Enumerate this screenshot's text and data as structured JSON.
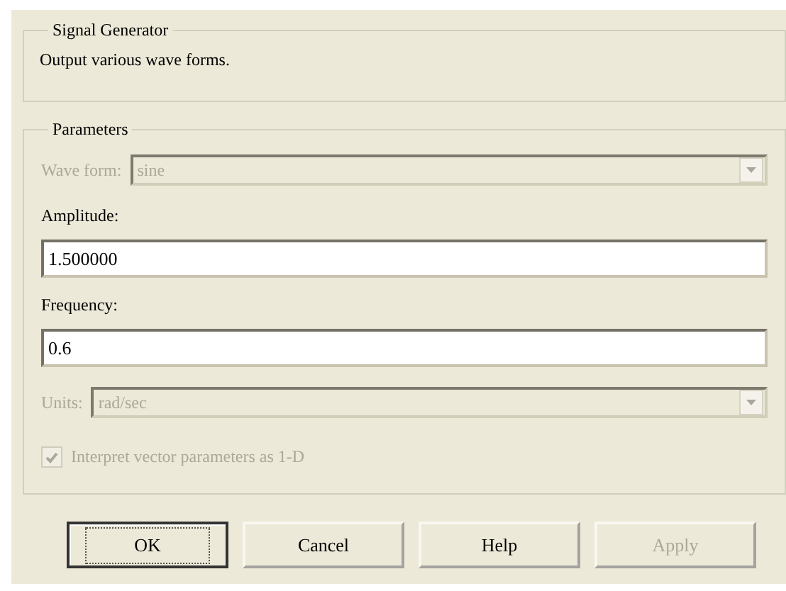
{
  "description_group": {
    "title": "Signal Generator",
    "text": "Output various wave forms."
  },
  "parameters": {
    "title": "Parameters",
    "fields": [
      {
        "kind": "dropdown",
        "label": "Wave form:",
        "value": "sine",
        "disabled": true
      },
      {
        "kind": "text",
        "label": "Amplitude:",
        "value": "1.500000",
        "disabled": false
      },
      {
        "kind": "text",
        "label": "Frequency:",
        "value": "0.6",
        "disabled": false
      },
      {
        "kind": "dropdown",
        "label": "Units:",
        "value": "rad/sec",
        "disabled": true
      },
      {
        "kind": "checkbox",
        "label": "Interpret vector parameters as 1-D",
        "checked": true,
        "disabled": true
      }
    ]
  },
  "buttons": [
    {
      "label": "OK",
      "default": true,
      "disabled": false
    },
    {
      "label": "Cancel",
      "default": false,
      "disabled": false
    },
    {
      "label": "Help",
      "default": false,
      "disabled": false
    },
    {
      "label": "Apply",
      "default": false,
      "disabled": true
    }
  ]
}
